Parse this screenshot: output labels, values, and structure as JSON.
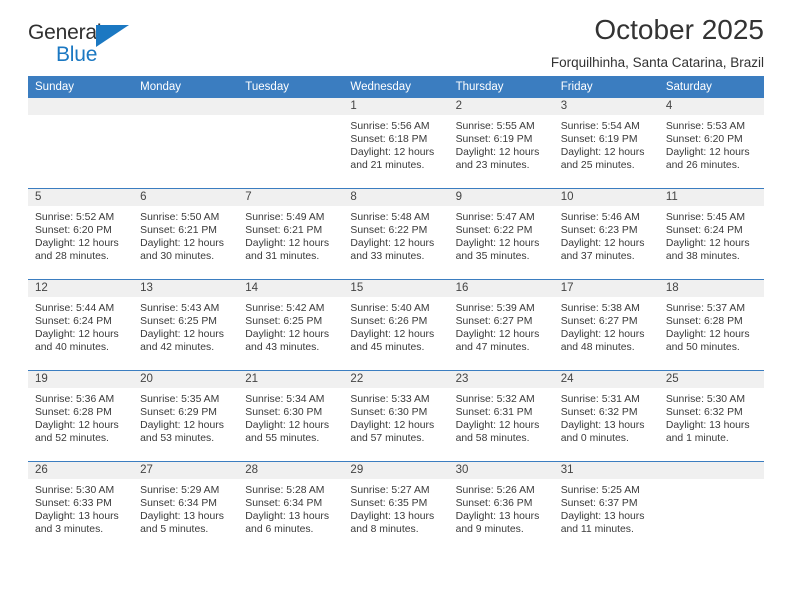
{
  "brand": {
    "name_top": "General",
    "name_bottom": "Blue",
    "triangle_color": "#1b78c2"
  },
  "header": {
    "title": "October 2025",
    "subtitle": "Forquilhinha, Santa Catarina, Brazil"
  },
  "theme": {
    "header_row_bg": "#3b7dc0",
    "day_band_bg": "#f0f0f0",
    "text_color": "#3a3a3a"
  },
  "weekday_headers": [
    "Sunday",
    "Monday",
    "Tuesday",
    "Wednesday",
    "Thursday",
    "Friday",
    "Saturday"
  ],
  "labels": {
    "sunrise": "Sunrise:",
    "sunset": "Sunset:",
    "daylight": "Daylight:"
  },
  "weeks": [
    [
      {
        "day": "",
        "empty": true
      },
      {
        "day": "",
        "empty": true
      },
      {
        "day": "",
        "empty": true
      },
      {
        "day": "1",
        "sunrise": "Sunrise: 5:56 AM",
        "sunset": "Sunset: 6:18 PM",
        "daylight_1": "Daylight: 12 hours",
        "daylight_2": "and 21 minutes."
      },
      {
        "day": "2",
        "sunrise": "Sunrise: 5:55 AM",
        "sunset": "Sunset: 6:19 PM",
        "daylight_1": "Daylight: 12 hours",
        "daylight_2": "and 23 minutes."
      },
      {
        "day": "3",
        "sunrise": "Sunrise: 5:54 AM",
        "sunset": "Sunset: 6:19 PM",
        "daylight_1": "Daylight: 12 hours",
        "daylight_2": "and 25 minutes."
      },
      {
        "day": "4",
        "sunrise": "Sunrise: 5:53 AM",
        "sunset": "Sunset: 6:20 PM",
        "daylight_1": "Daylight: 12 hours",
        "daylight_2": "and 26 minutes."
      }
    ],
    [
      {
        "day": "5",
        "sunrise": "Sunrise: 5:52 AM",
        "sunset": "Sunset: 6:20 PM",
        "daylight_1": "Daylight: 12 hours",
        "daylight_2": "and 28 minutes."
      },
      {
        "day": "6",
        "sunrise": "Sunrise: 5:50 AM",
        "sunset": "Sunset: 6:21 PM",
        "daylight_1": "Daylight: 12 hours",
        "daylight_2": "and 30 minutes."
      },
      {
        "day": "7",
        "sunrise": "Sunrise: 5:49 AM",
        "sunset": "Sunset: 6:21 PM",
        "daylight_1": "Daylight: 12 hours",
        "daylight_2": "and 31 minutes."
      },
      {
        "day": "8",
        "sunrise": "Sunrise: 5:48 AM",
        "sunset": "Sunset: 6:22 PM",
        "daylight_1": "Daylight: 12 hours",
        "daylight_2": "and 33 minutes."
      },
      {
        "day": "9",
        "sunrise": "Sunrise: 5:47 AM",
        "sunset": "Sunset: 6:22 PM",
        "daylight_1": "Daylight: 12 hours",
        "daylight_2": "and 35 minutes."
      },
      {
        "day": "10",
        "sunrise": "Sunrise: 5:46 AM",
        "sunset": "Sunset: 6:23 PM",
        "daylight_1": "Daylight: 12 hours",
        "daylight_2": "and 37 minutes."
      },
      {
        "day": "11",
        "sunrise": "Sunrise: 5:45 AM",
        "sunset": "Sunset: 6:24 PM",
        "daylight_1": "Daylight: 12 hours",
        "daylight_2": "and 38 minutes."
      }
    ],
    [
      {
        "day": "12",
        "sunrise": "Sunrise: 5:44 AM",
        "sunset": "Sunset: 6:24 PM",
        "daylight_1": "Daylight: 12 hours",
        "daylight_2": "and 40 minutes."
      },
      {
        "day": "13",
        "sunrise": "Sunrise: 5:43 AM",
        "sunset": "Sunset: 6:25 PM",
        "daylight_1": "Daylight: 12 hours",
        "daylight_2": "and 42 minutes."
      },
      {
        "day": "14",
        "sunrise": "Sunrise: 5:42 AM",
        "sunset": "Sunset: 6:25 PM",
        "daylight_1": "Daylight: 12 hours",
        "daylight_2": "and 43 minutes."
      },
      {
        "day": "15",
        "sunrise": "Sunrise: 5:40 AM",
        "sunset": "Sunset: 6:26 PM",
        "daylight_1": "Daylight: 12 hours",
        "daylight_2": "and 45 minutes."
      },
      {
        "day": "16",
        "sunrise": "Sunrise: 5:39 AM",
        "sunset": "Sunset: 6:27 PM",
        "daylight_1": "Daylight: 12 hours",
        "daylight_2": "and 47 minutes."
      },
      {
        "day": "17",
        "sunrise": "Sunrise: 5:38 AM",
        "sunset": "Sunset: 6:27 PM",
        "daylight_1": "Daylight: 12 hours",
        "daylight_2": "and 48 minutes."
      },
      {
        "day": "18",
        "sunrise": "Sunrise: 5:37 AM",
        "sunset": "Sunset: 6:28 PM",
        "daylight_1": "Daylight: 12 hours",
        "daylight_2": "and 50 minutes."
      }
    ],
    [
      {
        "day": "19",
        "sunrise": "Sunrise: 5:36 AM",
        "sunset": "Sunset: 6:28 PM",
        "daylight_1": "Daylight: 12 hours",
        "daylight_2": "and 52 minutes."
      },
      {
        "day": "20",
        "sunrise": "Sunrise: 5:35 AM",
        "sunset": "Sunset: 6:29 PM",
        "daylight_1": "Daylight: 12 hours",
        "daylight_2": "and 53 minutes."
      },
      {
        "day": "21",
        "sunrise": "Sunrise: 5:34 AM",
        "sunset": "Sunset: 6:30 PM",
        "daylight_1": "Daylight: 12 hours",
        "daylight_2": "and 55 minutes."
      },
      {
        "day": "22",
        "sunrise": "Sunrise: 5:33 AM",
        "sunset": "Sunset: 6:30 PM",
        "daylight_1": "Daylight: 12 hours",
        "daylight_2": "and 57 minutes."
      },
      {
        "day": "23",
        "sunrise": "Sunrise: 5:32 AM",
        "sunset": "Sunset: 6:31 PM",
        "daylight_1": "Daylight: 12 hours",
        "daylight_2": "and 58 minutes."
      },
      {
        "day": "24",
        "sunrise": "Sunrise: 5:31 AM",
        "sunset": "Sunset: 6:32 PM",
        "daylight_1": "Daylight: 13 hours",
        "daylight_2": "and 0 minutes."
      },
      {
        "day": "25",
        "sunrise": "Sunrise: 5:30 AM",
        "sunset": "Sunset: 6:32 PM",
        "daylight_1": "Daylight: 13 hours",
        "daylight_2": "and 1 minute."
      }
    ],
    [
      {
        "day": "26",
        "sunrise": "Sunrise: 5:30 AM",
        "sunset": "Sunset: 6:33 PM",
        "daylight_1": "Daylight: 13 hours",
        "daylight_2": "and 3 minutes."
      },
      {
        "day": "27",
        "sunrise": "Sunrise: 5:29 AM",
        "sunset": "Sunset: 6:34 PM",
        "daylight_1": "Daylight: 13 hours",
        "daylight_2": "and 5 minutes."
      },
      {
        "day": "28",
        "sunrise": "Sunrise: 5:28 AM",
        "sunset": "Sunset: 6:34 PM",
        "daylight_1": "Daylight: 13 hours",
        "daylight_2": "and 6 minutes."
      },
      {
        "day": "29",
        "sunrise": "Sunrise: 5:27 AM",
        "sunset": "Sunset: 6:35 PM",
        "daylight_1": "Daylight: 13 hours",
        "daylight_2": "and 8 minutes."
      },
      {
        "day": "30",
        "sunrise": "Sunrise: 5:26 AM",
        "sunset": "Sunset: 6:36 PM",
        "daylight_1": "Daylight: 13 hours",
        "daylight_2": "and 9 minutes."
      },
      {
        "day": "31",
        "sunrise": "Sunrise: 5:25 AM",
        "sunset": "Sunset: 6:37 PM",
        "daylight_1": "Daylight: 13 hours",
        "daylight_2": "and 11 minutes."
      },
      {
        "day": "",
        "empty": true
      }
    ]
  ]
}
